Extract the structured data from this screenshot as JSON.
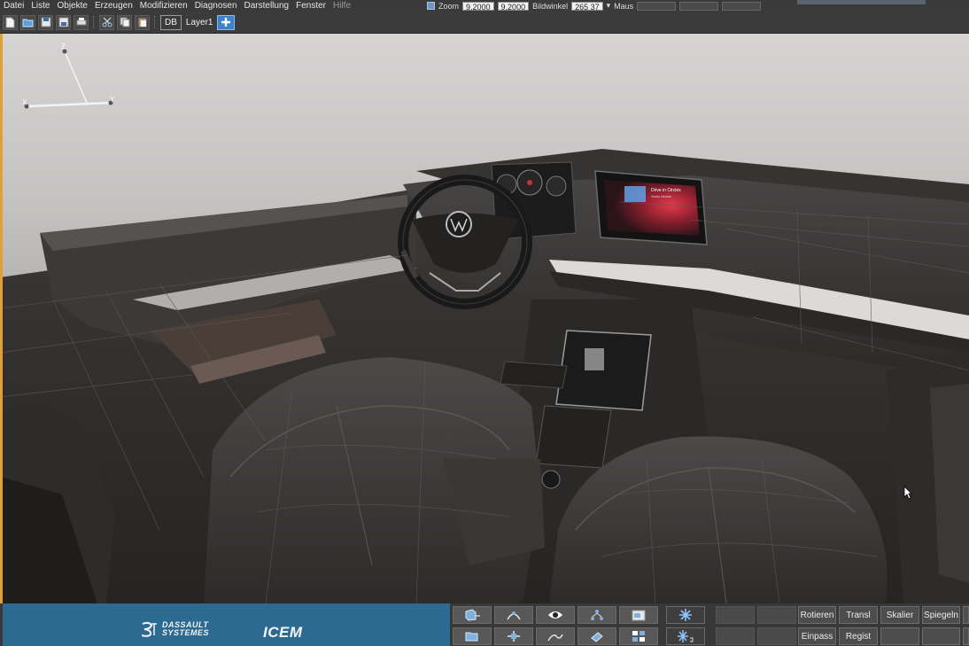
{
  "menubar": {
    "items": [
      "Datei",
      "Liste",
      "Objekte",
      "Erzeugen",
      "Modifizieren",
      "Diagnosen",
      "Darstellung",
      "Fenster",
      "Hilfe"
    ],
    "zoom_label": "Zoom",
    "zoom_value_1": "9.2000",
    "zoom_value_2": "9.2000",
    "angle_label": "Bildwinkel",
    "angle_value": "265 37",
    "mouse_label": "Maus"
  },
  "toolbar": {
    "db_label": "DB",
    "layer_label": "Layer1",
    "icons": [
      "new-file-icon",
      "open-folder-icon",
      "save-icon",
      "save-as-icon",
      "print-icon",
      "cut-icon",
      "copy-icon",
      "paste-icon",
      "add-layer-icon"
    ]
  },
  "axes": {
    "x_label": "X",
    "y_label": "Y",
    "z_label": "Z"
  },
  "infotainment": {
    "title": "Drive in Circles",
    "subtitle": "Sonic Hearts"
  },
  "bottombar": {
    "vendor_logo_text_1": "DASSAULT",
    "vendor_logo_text_2": "SYSTEMES",
    "product_logo_text": "ICEM",
    "buttons": {
      "rotieren": "Rotieren",
      "transl": "Transl",
      "skalier": "Skalier",
      "spiegeln": "Spiegeln",
      "einpass": "Einpass",
      "regist": "Regist"
    },
    "brand_color": "#2c6a91"
  }
}
